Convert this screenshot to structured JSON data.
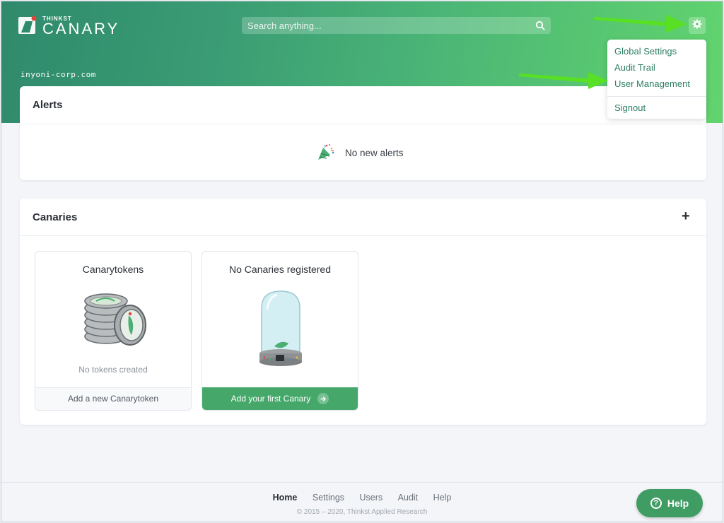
{
  "brand": {
    "small": "THINKST",
    "name": "CANARY"
  },
  "search": {
    "placeholder": "Search anything..."
  },
  "domain": "inyoni-corp.com",
  "settings_menu": {
    "items": [
      "Global Settings",
      "Audit Trail",
      "User Management",
      "Signout"
    ]
  },
  "alerts": {
    "title": "Alerts",
    "empty_text": "No new alerts"
  },
  "canaries": {
    "title": "Canaries",
    "add_symbol": "+",
    "tokens_tile": {
      "title": "Canarytokens",
      "subtitle": "No tokens created",
      "action": "Add a new Canarytoken"
    },
    "birds_tile": {
      "title": "No Canaries registered",
      "action": "Add your first Canary"
    }
  },
  "footer": {
    "nav": [
      "Home",
      "Settings",
      "Users",
      "Audit",
      "Help"
    ],
    "copyright": "© 2015 – 2020, Thinkst Applied Research"
  },
  "help_button": {
    "label": "Help",
    "icon": "?"
  },
  "icons": {
    "search": "search-icon",
    "settings": "gear-icon",
    "confetti": "party-popper-icon",
    "add": "plus-icon",
    "arrow": "arrow-right-icon",
    "help": "question-icon"
  },
  "colors": {
    "brand_green": "#45a86a",
    "link_green": "#2e7f62",
    "annotation_arrow": "#58e024"
  }
}
